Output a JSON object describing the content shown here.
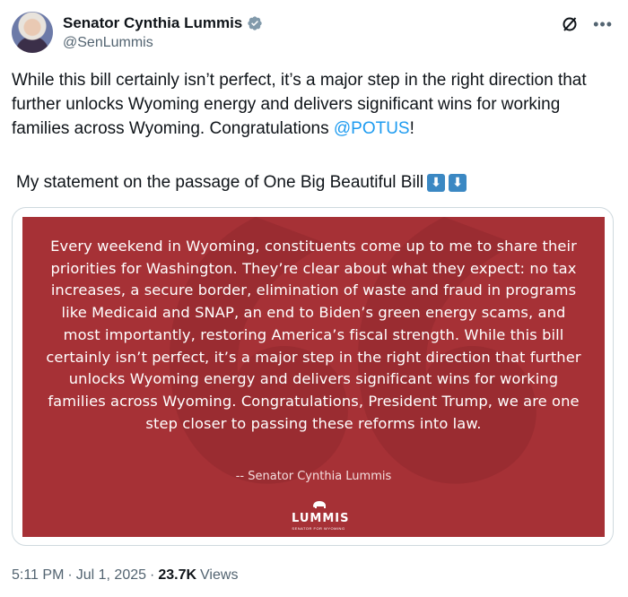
{
  "author": {
    "display_name": "Senator Cynthia Lummis",
    "handle": "@SenLummis"
  },
  "icons": {
    "verified": "verified-badge-icon",
    "grok": "grok-icon",
    "more": "more-icon"
  },
  "tweet": {
    "text_main": "While this bill certainly isn’t perfect, it’s a major step in the right direction that further unlocks Wyoming energy and delivers significant wins for working families across Wyoming. Congratulations ",
    "mention": "@POTUS",
    "text_end": "!",
    "statement_line": "My statement on the passage of One Big Beautiful Bill",
    "arrow_glyph": "⬇"
  },
  "media": {
    "statement_text": "Every weekend in Wyoming, constituents come up to me to share their priorities for Washington. They’re clear about what they expect: no tax increases, a secure border, elimination of waste and fraud in programs like Medicaid and SNAP, an end to Biden’s green energy scams, and most importantly, restoring America’s fiscal strength. While this bill certainly isn’t perfect, it’s a major step in the right direction that further unlocks Wyoming energy and delivers significant wins for working families across Wyoming. Congratulations, President Trump, we are one step closer to passing these reforms into law.",
    "attribution": "-- Senator Cynthia Lummis",
    "logo_word": "LUMMIS",
    "logo_sub": "SENATOR FOR WYOMING",
    "background_color": "#a63136"
  },
  "meta": {
    "time": "5:11 PM",
    "separator": "·",
    "date": "Jul 1, 2025",
    "views_count": "23.7K",
    "views_label": "Views"
  },
  "colors": {
    "link": "#1d9bf0",
    "secondary_text": "#536471",
    "verified": "#829aab"
  }
}
